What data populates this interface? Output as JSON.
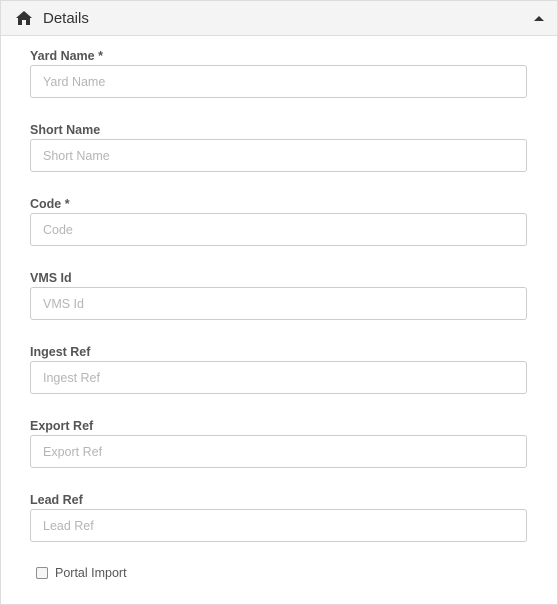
{
  "panel": {
    "title": "Details",
    "header_icon": "home-icon",
    "collapse_icon": "caret-up-icon"
  },
  "form": {
    "fields": [
      {
        "label": "Yard Name *",
        "placeholder": "Yard Name",
        "value": ""
      },
      {
        "label": "Short Name",
        "placeholder": "Short Name",
        "value": ""
      },
      {
        "label": "Code *",
        "placeholder": "Code",
        "value": ""
      },
      {
        "label": "VMS Id",
        "placeholder": "VMS Id",
        "value": ""
      },
      {
        "label": "Ingest Ref",
        "placeholder": "Ingest Ref",
        "value": ""
      },
      {
        "label": "Export Ref",
        "placeholder": "Export Ref",
        "value": ""
      },
      {
        "label": "Lead Ref",
        "placeholder": "Lead Ref",
        "value": ""
      }
    ],
    "checkbox": {
      "label": "Portal Import",
      "checked": false
    }
  }
}
